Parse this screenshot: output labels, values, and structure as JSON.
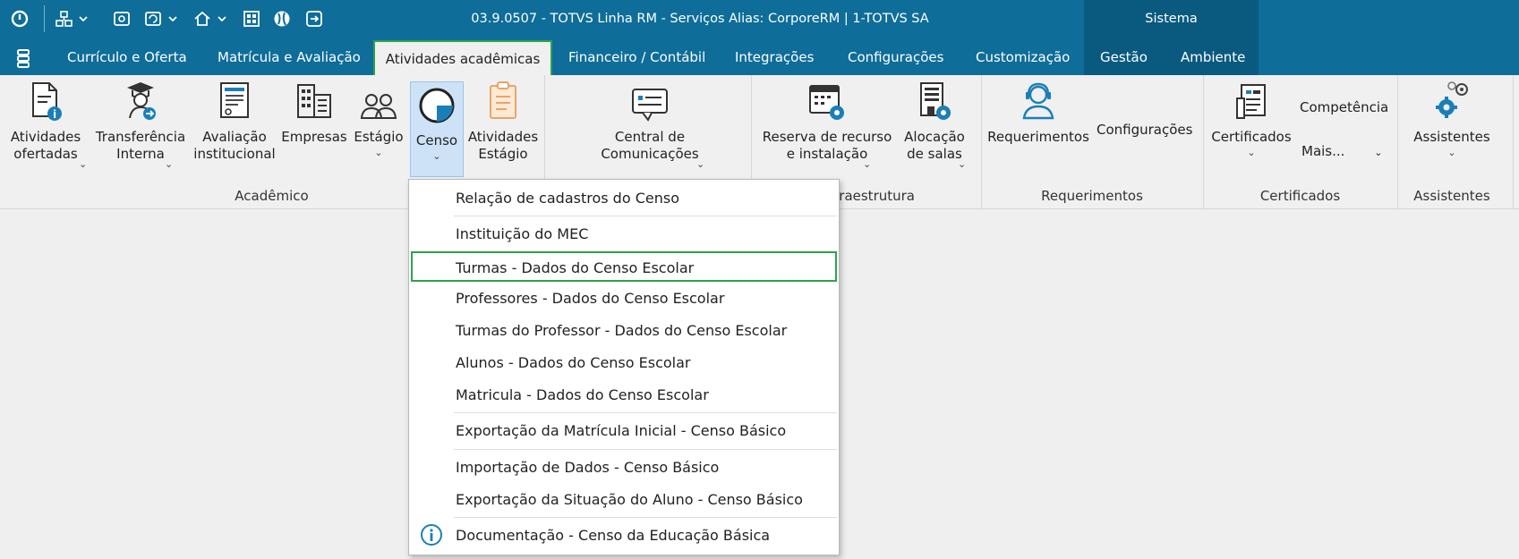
{
  "titlebar": {
    "title": "03.9.0507 - TOTVS Linha RM - Serviços  Alias: CorporeRM | 1-TOTVS SA",
    "context_tab": "Sistema",
    "quick_access_icons": [
      "power-icon",
      "org-chart-icon",
      "screen-icon",
      "refresh-screen-icon",
      "home-icon",
      "grid-icon",
      "globe-icon",
      "exit-icon"
    ]
  },
  "menu": {
    "tabs": [
      {
        "label": "Currículo e Oferta"
      },
      {
        "label": "Matrícula e Avaliação"
      },
      {
        "label": "Atividades acadêmicas",
        "active": true
      },
      {
        "label": "Financeiro / Contábil"
      },
      {
        "label": "Integrações"
      },
      {
        "label": "Configurações"
      },
      {
        "label": "Customização"
      },
      {
        "label": "Gestão"
      },
      {
        "label": "Ambiente"
      }
    ]
  },
  "ribbon": {
    "groups": {
      "academico": {
        "label": "Acadêmico",
        "buttons": [
          {
            "label": "Atividades\nofertadas",
            "chevron": "⌄",
            "icon": "document-info-icon"
          },
          {
            "label": "Transferência\nInterna",
            "chevron": "⌄",
            "icon": "graduate-transfer-icon"
          },
          {
            "label": "Avaliação\ninstitucional",
            "icon": "evaluation-form-icon"
          },
          {
            "label": "Empresas",
            "icon": "buildings-icon"
          },
          {
            "label": "Estágio",
            "chevron": "⌄",
            "icon": "people-icon"
          },
          {
            "label": "Censo",
            "chevron": "⌄",
            "icon": "census-chart-icon",
            "pressed": true
          },
          {
            "label": "Atividades\nEstágio",
            "icon": "clipboard-icon"
          }
        ]
      },
      "comunicacao": {
        "buttons": [
          {
            "label": "Central de\nComunicações",
            "chevron": "⌄",
            "icon": "message-icon"
          }
        ]
      },
      "infraestrutura": {
        "label_visible": "fraestrutura",
        "buttons": [
          {
            "label": "Reserva de recurso\ne instalação",
            "chevron": "⌄",
            "icon": "calendar-gear-icon"
          },
          {
            "label": "Alocação\nde salas",
            "chevron": "⌄",
            "icon": "room-gear-icon"
          }
        ]
      },
      "requerimentos": {
        "label": "Requerimentos",
        "buttons": [
          {
            "label": "Requerimentos",
            "icon": "headset-user-icon"
          }
        ],
        "small_label": "Configurações"
      },
      "certificados": {
        "label": "Certificados",
        "buttons": [
          {
            "label": "Certificados",
            "chevron": "⌄",
            "icon": "certificate-icon"
          }
        ],
        "small_top": "Competência",
        "small_more": "Mais...",
        "small_more_chevron": "⌄"
      },
      "assistentes": {
        "label": "Assistentes",
        "buttons": [
          {
            "label": "Assistentes",
            "chevron": "⌄",
            "icon": "gears-icon"
          }
        ]
      }
    }
  },
  "dropdown": {
    "items": [
      {
        "label": "Relação de cadastros do Censo"
      },
      {
        "label": "Instituição do MEC"
      },
      {
        "label": "Turmas - Dados do Censo Escolar",
        "selected": true
      },
      {
        "label": "Professores - Dados do Censo Escolar"
      },
      {
        "label": "Turmas do Professor - Dados do Censo Escolar"
      },
      {
        "label": "Alunos - Dados do Censo Escolar"
      },
      {
        "label": "Matricula - Dados do Censo Escolar"
      },
      {
        "label": "Exportação da Matrícula Inicial - Censo Básico"
      },
      {
        "label": "Importação de Dados - Censo Básico"
      },
      {
        "label": "Exportação da Situação do Aluno - Censo Básico"
      },
      {
        "label": "Documentação - Censo da Educação Básica",
        "icon": "info-icon"
      }
    ]
  },
  "colors": {
    "titlebar": "#0e6d99",
    "context_tab": "#0a5a80",
    "highlight_border": "#2ea24a",
    "pressed_button": "#cde2f6"
  }
}
